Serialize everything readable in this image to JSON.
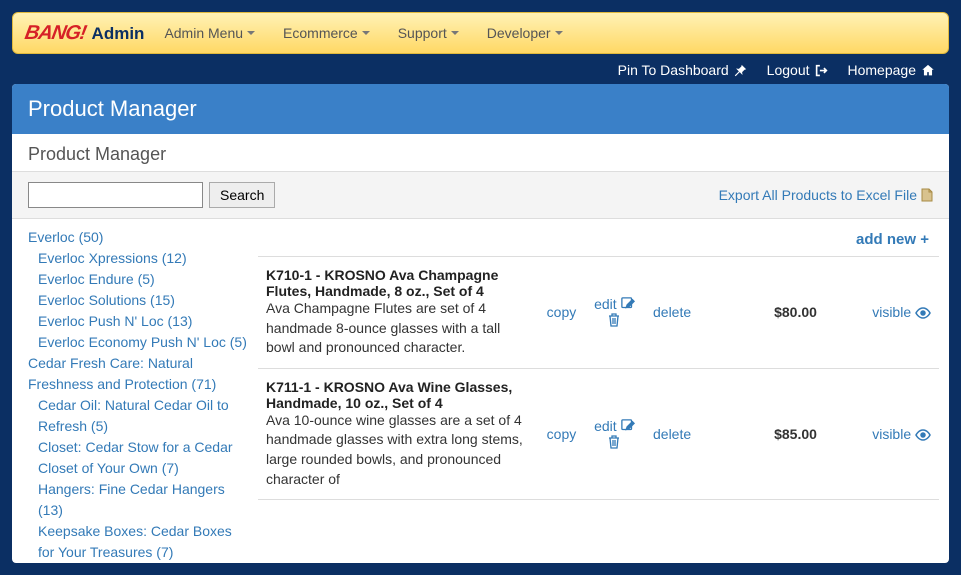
{
  "brand": {
    "logo": "BANG!",
    "suffix": "Admin"
  },
  "nav": [
    {
      "label": "Admin Menu"
    },
    {
      "label": "Ecommerce"
    },
    {
      "label": "Support"
    },
    {
      "label": "Developer"
    }
  ],
  "toplinks": {
    "pin": "Pin To Dashboard",
    "logout": "Logout",
    "home": "Homepage"
  },
  "page": {
    "title": "Product Manager",
    "subtitle": "Product Manager",
    "search_button": "Search",
    "export_label": "Export All Products to Excel File",
    "add_new": "add new"
  },
  "categories": [
    {
      "label": "Everloc (50)",
      "sub": false
    },
    {
      "label": "Everloc Xpressions (12)",
      "sub": true
    },
    {
      "label": "Everloc Endure (5)",
      "sub": true
    },
    {
      "label": "Everloc Solutions (15)",
      "sub": true
    },
    {
      "label": "Everloc Push N' Loc (13)",
      "sub": true
    },
    {
      "label": "Everloc Economy Push N' Loc (5)",
      "sub": true
    },
    {
      "label": "Cedar Fresh Care: Natural Freshness and Protection (71)",
      "sub": false
    },
    {
      "label": "Cedar Oil: Natural Cedar Oil to Refresh (5)",
      "sub": true
    },
    {
      "label": "Closet: Cedar Stow for a Cedar Closet of Your Own (7)",
      "sub": true
    },
    {
      "label": "Hangers: Fine Cedar Hangers (13)",
      "sub": true
    },
    {
      "label": "Keepsake Boxes: Cedar Boxes for Your Treasures (7)",
      "sub": true
    }
  ],
  "products": [
    {
      "title": "K710-1 - KROSNO Ava Champagne Flutes, Handmade, 8 oz., Set of 4",
      "desc": "Ava Champagne Flutes are set of 4 handmade 8-ounce glasses with a tall bowl and pronounced character.",
      "price": "$80.00",
      "copy": "copy",
      "edit": "edit",
      "delete": "delete",
      "visible": "visible"
    },
    {
      "title": "K711-1 - KROSNO Ava Wine Glasses, Handmade, 10 oz., Set of 4",
      "desc": "Ava 10-ounce wine glasses are a set of 4 handmade glasses with extra long stems, large rounded bowls, and pronounced character of",
      "price": "$85.00",
      "copy": "copy",
      "edit": "edit",
      "delete": "delete",
      "visible": "visible"
    }
  ]
}
